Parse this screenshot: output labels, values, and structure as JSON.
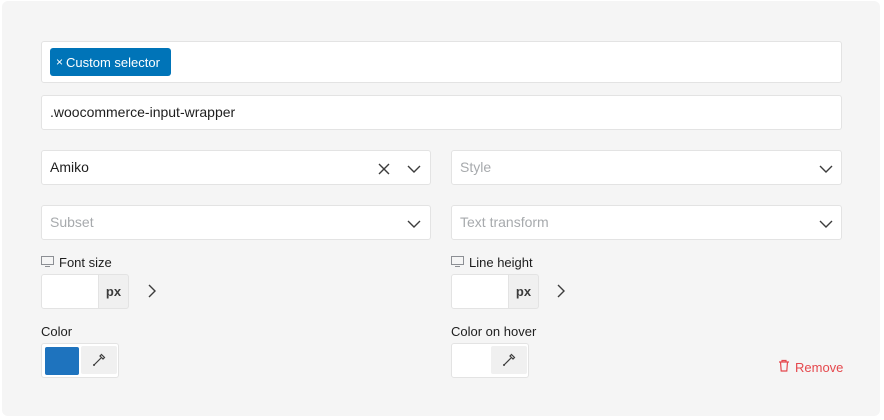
{
  "selector_tag": {
    "label": "Custom selector",
    "remove_glyph": "×"
  },
  "selector_value": ".woocommerce-input-wrapper",
  "font_family": {
    "value": "Amiko",
    "clear_icon": "close-icon",
    "dropdown_icon": "chevron-down-icon"
  },
  "style": {
    "placeholder": "Style"
  },
  "subset": {
    "placeholder": "Subset"
  },
  "text_transform": {
    "placeholder": "Text transform"
  },
  "font_size": {
    "label": "Font size",
    "value": "",
    "unit": "px",
    "device_icon": "desktop-icon"
  },
  "line_height": {
    "label": "Line height",
    "value": "",
    "unit": "px",
    "device_icon": "desktop-icon"
  },
  "color": {
    "label": "Color",
    "swatch": "#1e73be"
  },
  "color_hover": {
    "label": "Color on hover",
    "swatch": ""
  },
  "remove": {
    "label": "Remove",
    "color": "#e5484d"
  },
  "colors": {
    "panel_bg": "#f5f5f5",
    "accent": "#0074b8",
    "border": "#e3e3e3",
    "placeholder": "#a7aaad"
  }
}
